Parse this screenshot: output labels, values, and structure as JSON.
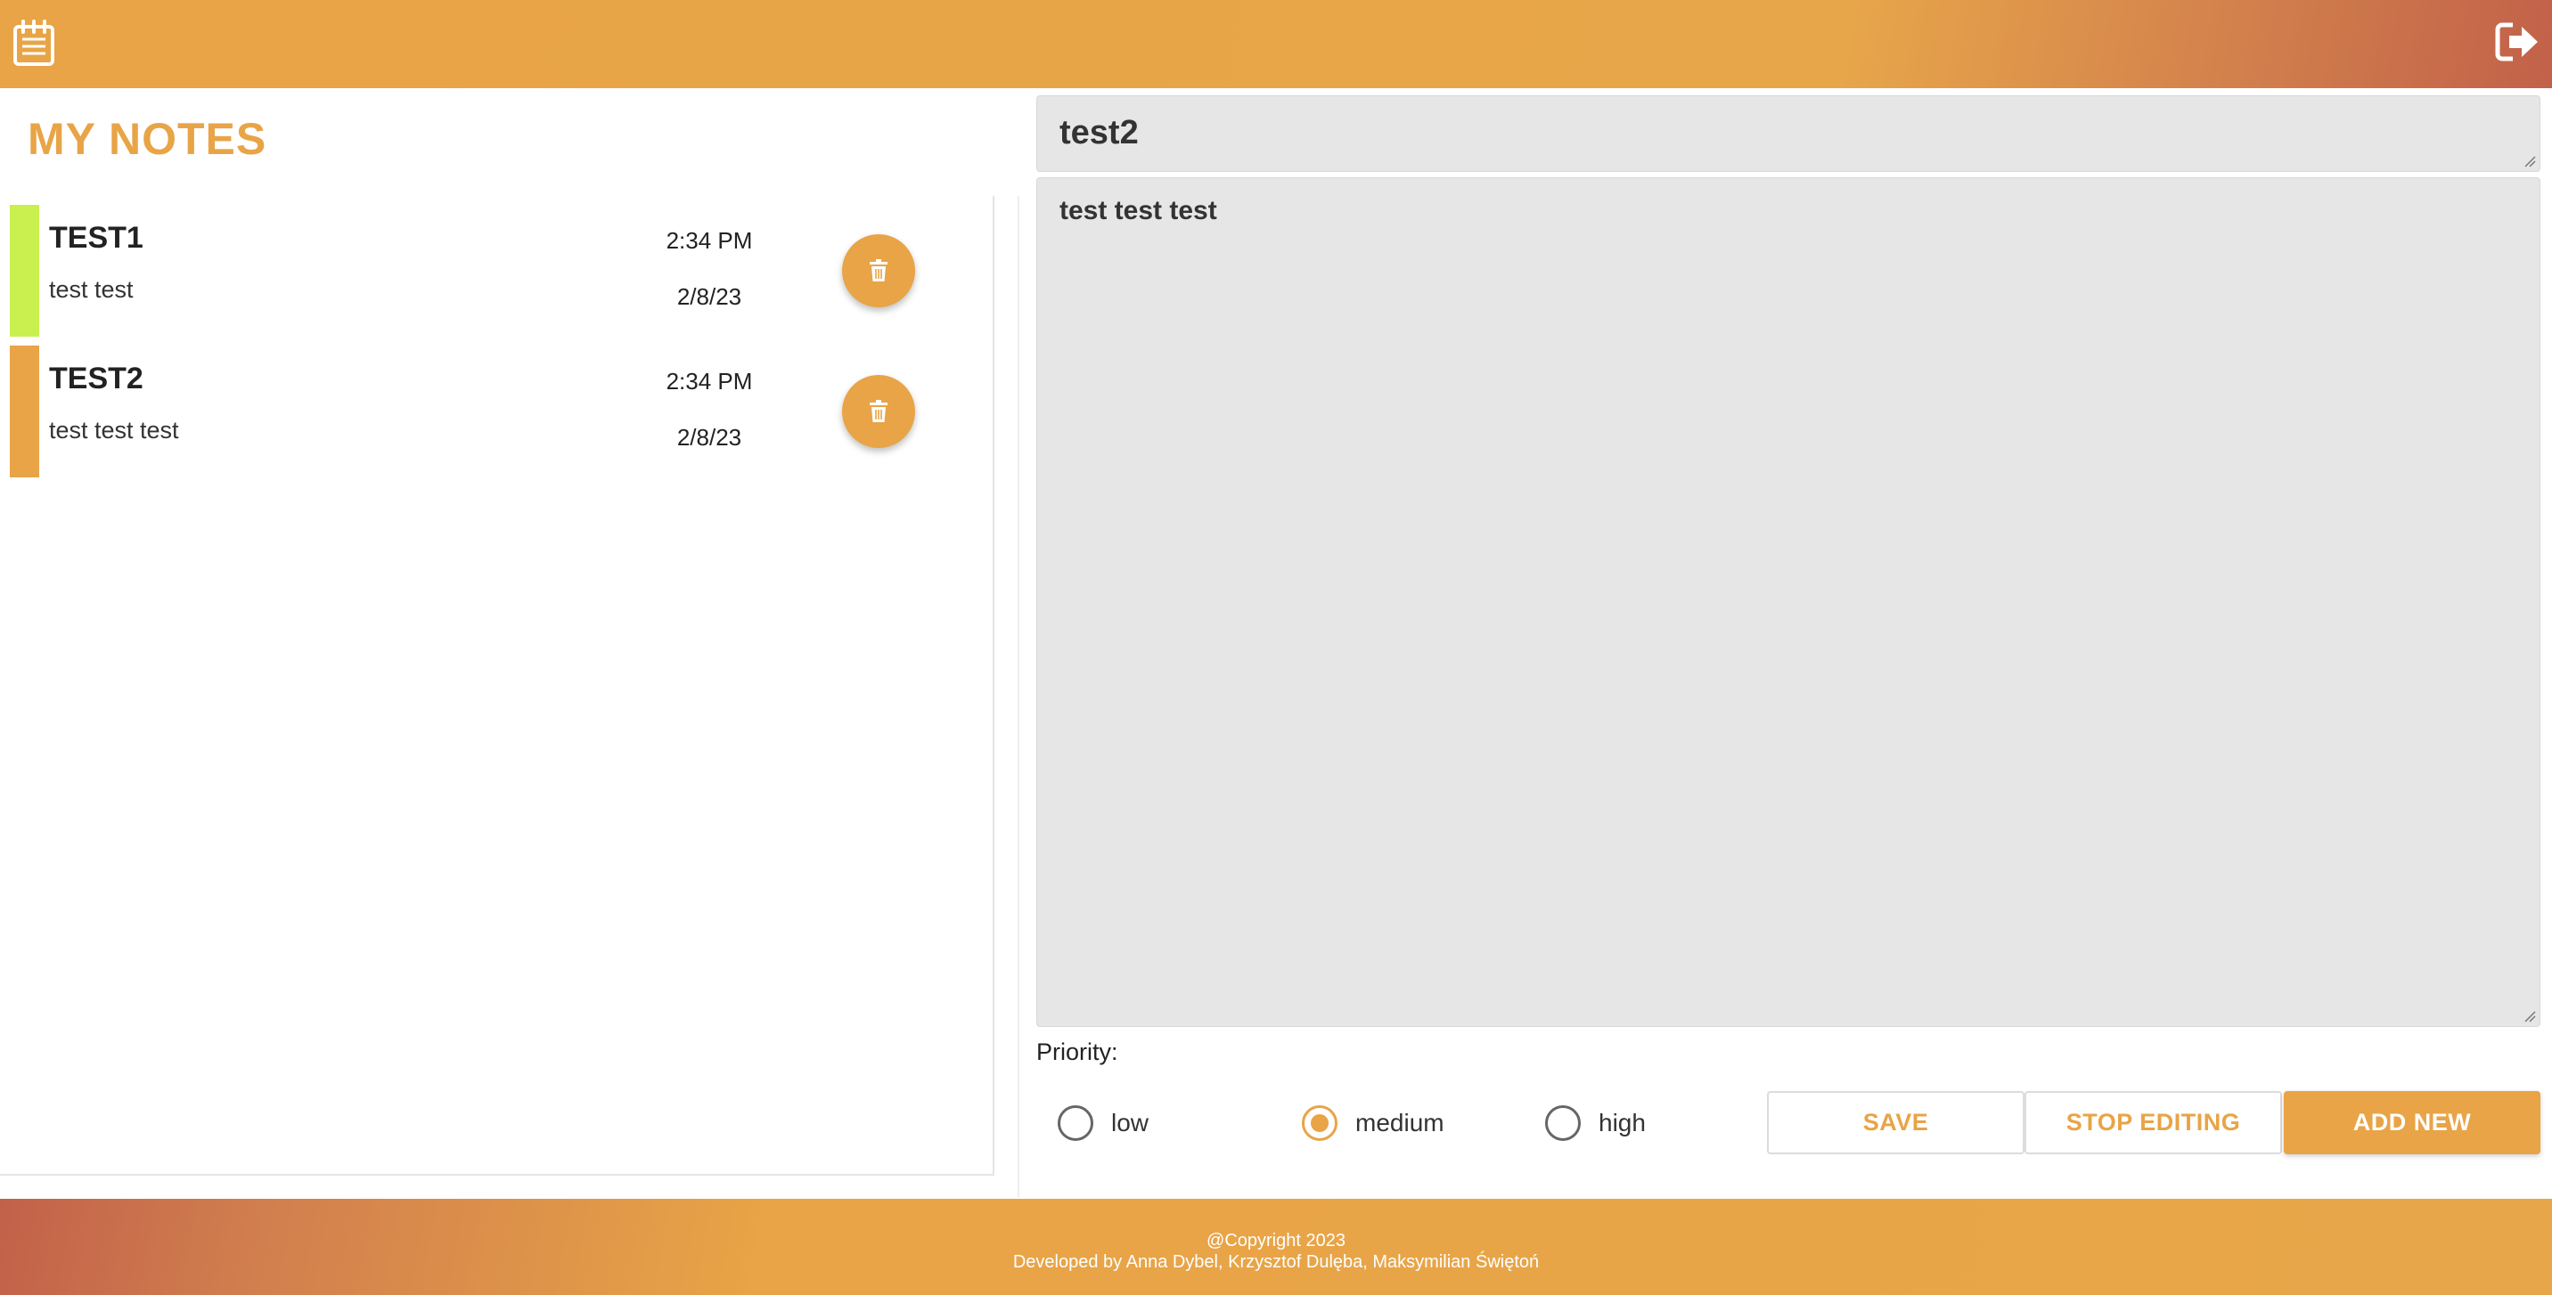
{
  "header": {
    "left_icon": "notepad-icon",
    "right_icon": "logout-icon"
  },
  "page_title": "MY NOTES",
  "notes": [
    {
      "title": "TEST1",
      "body": "test test",
      "time": "2:34 PM",
      "date": "2/8/23",
      "priority_color": "#c9f04e",
      "delete_icon": "trash-icon"
    },
    {
      "title": "TEST2",
      "body": "test test test",
      "time": "2:34 PM",
      "date": "2/8/23",
      "priority_color": "#e8a446",
      "delete_icon": "trash-icon"
    }
  ],
  "editor": {
    "title_value": "test2",
    "body_value": "test test test",
    "priority_label": "Priority:",
    "priority_options": [
      {
        "label": "low",
        "checked": false
      },
      {
        "label": "medium",
        "checked": true
      },
      {
        "label": "high",
        "checked": false
      }
    ],
    "save_label": "SAVE",
    "stop_editing_label": "STOP EDITING",
    "add_new_label": "ADD NEW"
  },
  "footer": {
    "copyright": "@Copyright 2023",
    "credits": "Developed by Anna Dybel, Krzysztof Dulęba, Maksymilian Świętoń"
  },
  "colors": {
    "accent": "#e8a446",
    "low_priority": "#c9f04e",
    "gradient_dark": "#c2614a",
    "field_bg": "#e6e6e6"
  }
}
